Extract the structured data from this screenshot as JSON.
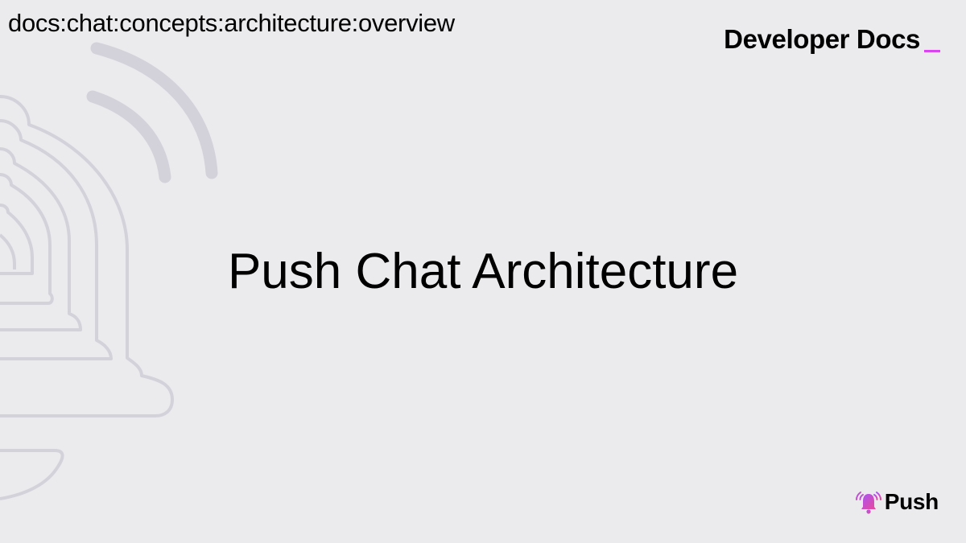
{
  "header": {
    "breadcrumb": "docs:chat:concepts:architecture:overview",
    "brand_title": "Developer Docs",
    "brand_cursor": "_"
  },
  "main": {
    "title": "Push Chat Architecture"
  },
  "footer": {
    "logo_text": "Push",
    "logo_icon": "bell-icon"
  },
  "colors": {
    "background": "#ebebee",
    "decorative_outline": "#d3d2da",
    "accent": "#d946ef",
    "bell_gradient_start": "#a855f7",
    "bell_gradient_end": "#ec4899"
  }
}
